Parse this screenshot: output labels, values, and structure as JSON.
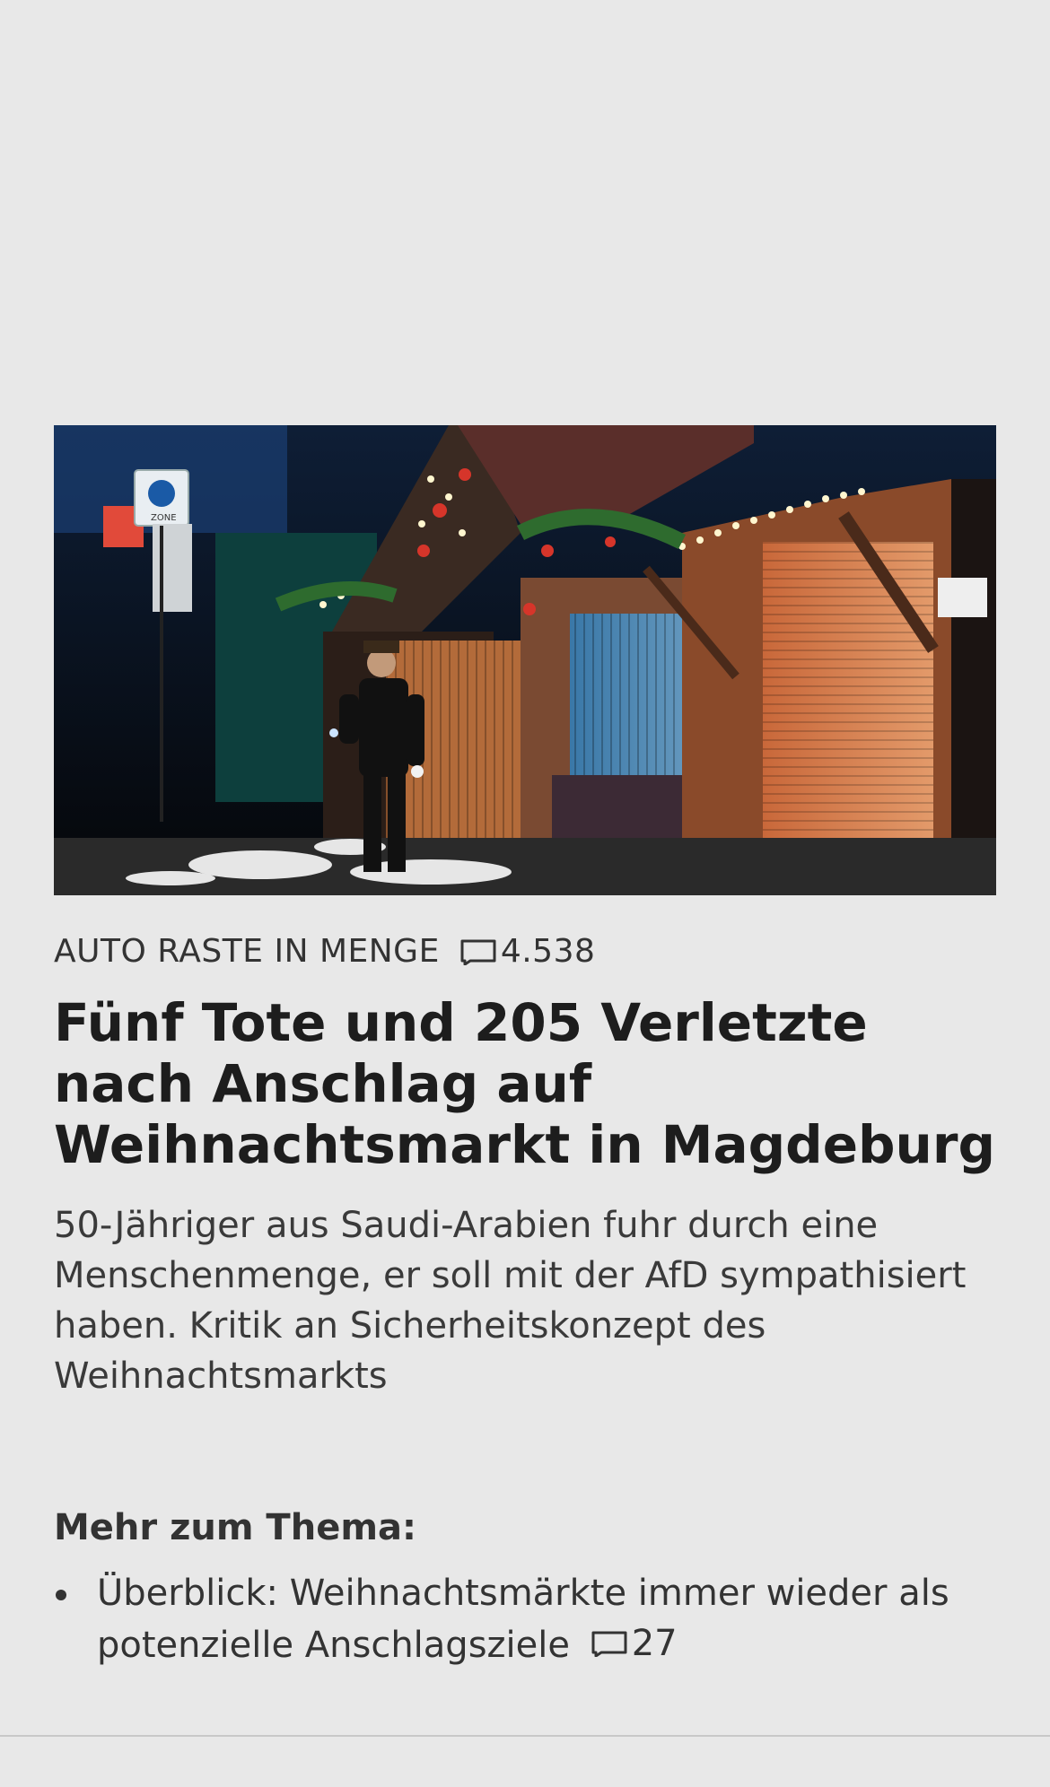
{
  "article": {
    "image": {
      "alt": "",
      "sign_text": "ZONE"
    },
    "kicker": "AUTO RASTE IN MENGE",
    "comment_count": "4.538",
    "headline": "Fünf Tote und 205 Verletzte nach Anschlag auf Weihnachtsmarkt in Magdeburg",
    "teaser": "50-Jähriger aus Saudi-Arabien fuhr durch eine Menschenmenge, er soll mit der AfD sympathisiert haben. Kritik an Sicherheitskonzept des Weihnachtsmarkts"
  },
  "more": {
    "title": "Mehr zum Thema:",
    "items": [
      {
        "label": "Überblick: Weihnachtsmärkte immer wieder als potenzielle Anschlagsziele",
        "comment_count": "27"
      }
    ]
  },
  "icons": {
    "comment": "comment-bubble-icon"
  },
  "colors": {
    "background": "#e8e8e8",
    "text": "#222222"
  }
}
